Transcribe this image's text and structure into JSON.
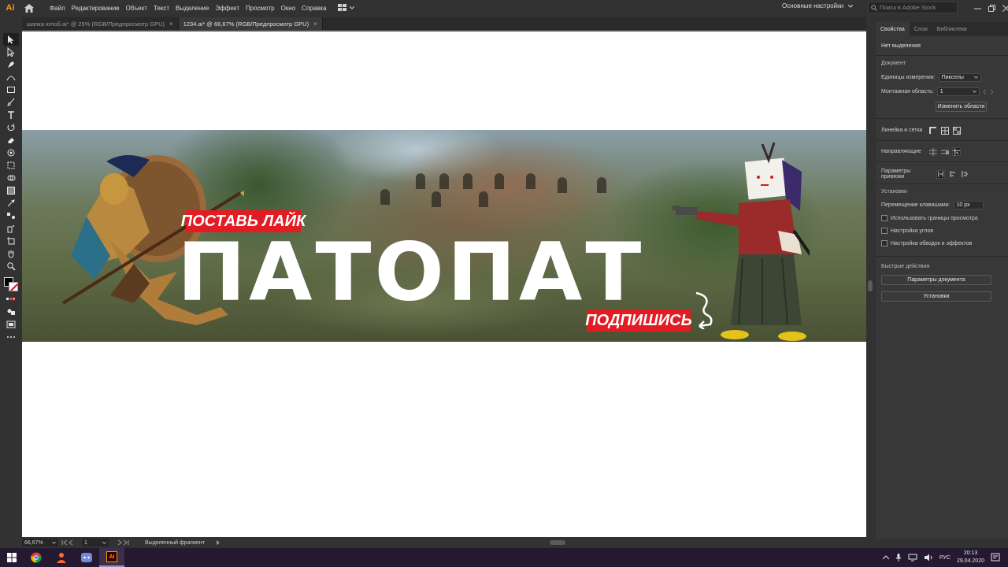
{
  "app": {
    "logo": "Ai"
  },
  "menu": [
    "Файл",
    "Редактирование",
    "Объект",
    "Текст",
    "Выделение",
    "Эффект",
    "Просмотр",
    "Окно",
    "Справка"
  ],
  "workspace": {
    "label": "Основные настройки"
  },
  "stock_search": {
    "placeholder": "Поиск в Adobe Stock"
  },
  "tabs": [
    {
      "label": "шапка ютюб.ai* @ 25% (RGB/Предпросмотр GPU)",
      "active": false
    },
    {
      "label": "1234.ai* @ 66,67% (RGB/Предпросмотр GPU)",
      "active": true
    }
  ],
  "tab_close_glyph": "×",
  "banner": {
    "title": "ПАТОПАТ",
    "like_text": "ПОСТАВЬ ЛАЙК",
    "subscribe_text": "ПОДПИШИСЬ",
    "accent_red": "#e31b23"
  },
  "statusbar": {
    "zoom": "66,67%",
    "artboard": "1",
    "status_text": "Выделенный фрагмент"
  },
  "panel": {
    "tabs": [
      "Свойства",
      "Слои",
      "Библиотеки"
    ],
    "no_selection": "Нет выделения",
    "document_header": "Документ",
    "units_label": "Единицы измерения:",
    "units_value": "Пикселы",
    "artboard_label": "Монтажная область:",
    "artboard_value": "1",
    "edit_artboards_btn": "Изменить области",
    "rulers_label": "Линейка и сетки",
    "guides_label": "Направляющие",
    "snap_label": "Параметры привязки",
    "prefs_header": "Установки",
    "keyboard_increment_label": "Перемещение клавишами:",
    "keyboard_increment_value": "10 px",
    "checkboxes": [
      "Использовать границы просмотра",
      "Настройка углов",
      "Настройка обводок и эффектов"
    ],
    "quick_actions_header": "Быстрые действия",
    "doc_setup_btn": "Параметры документа",
    "preferences_btn": "Установки"
  },
  "taskbar": {
    "lang": "РУС",
    "time": "20:13",
    "date": "29.04.2020",
    "ai_label": "Ai"
  }
}
